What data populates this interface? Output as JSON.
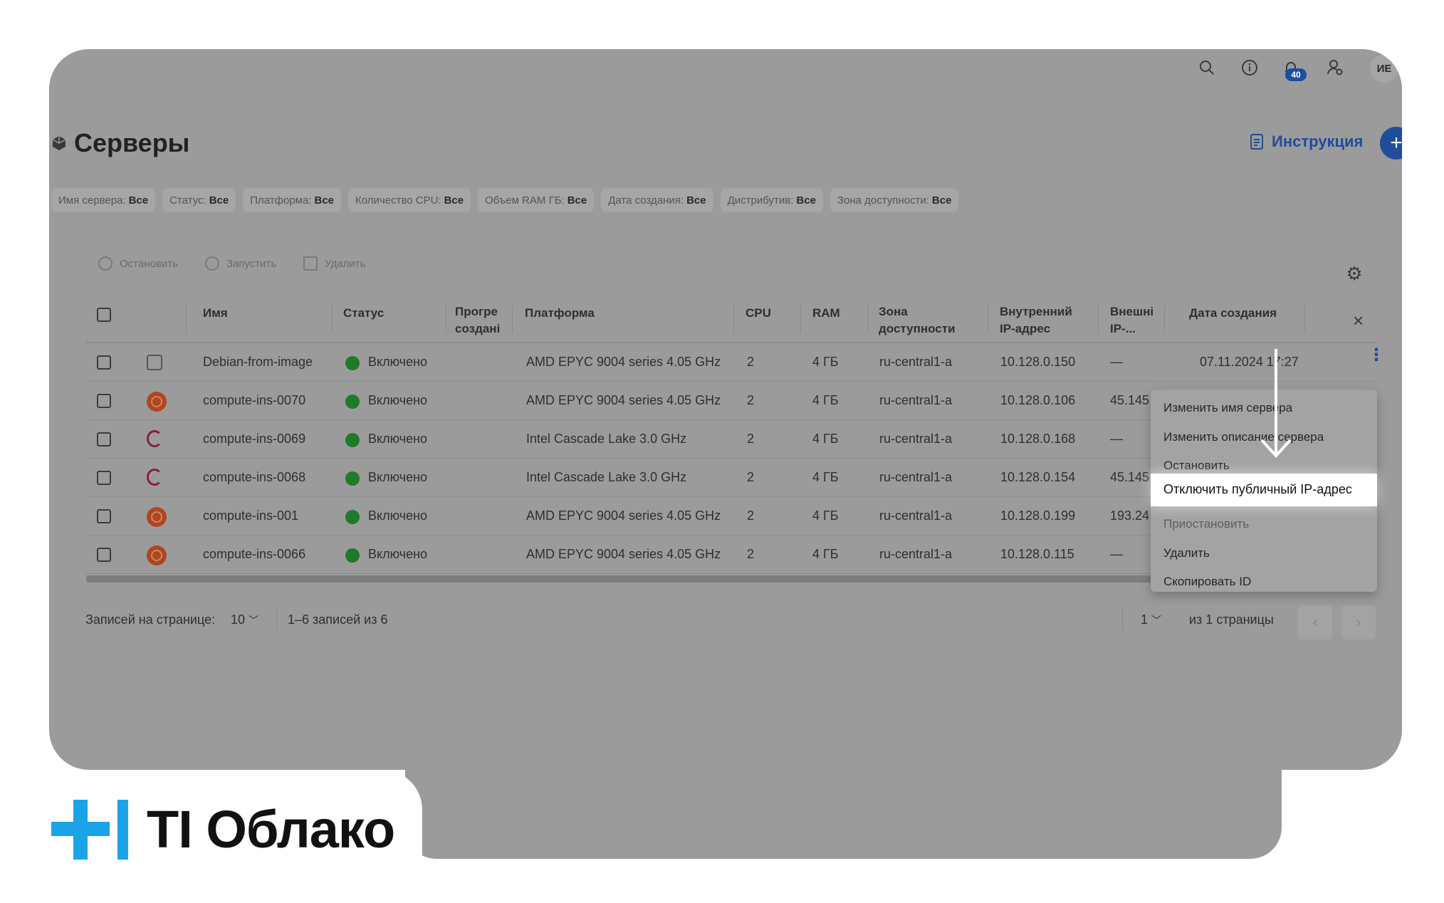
{
  "header": {
    "notification_count": "40",
    "avatar_initials": "ИЕ",
    "icons": [
      "search-icon",
      "info-icon",
      "bell-icon",
      "user-settings-icon"
    ]
  },
  "page": {
    "title": "Серверы",
    "instructions_label": "Инструкция",
    "add_label": "+"
  },
  "filters": [
    {
      "label": "Имя сервера:",
      "value": "Все"
    },
    {
      "label": "Статус:",
      "value": "Все"
    },
    {
      "label": "Платформа:",
      "value": "Все"
    },
    {
      "label": "Количество CPU:",
      "value": "Все"
    },
    {
      "label": "Объем RAM ГБ:",
      "value": "Все"
    },
    {
      "label": "Дата создания:",
      "value": "Все"
    },
    {
      "label": "Дистрибутив:",
      "value": "Все"
    },
    {
      "label": "Зона доступности:",
      "value": "Все"
    }
  ],
  "toolbar": {
    "stop_label": "Остановить",
    "start_label": "Запустить",
    "delete_label": "Удалить"
  },
  "table": {
    "columns": {
      "name": "Имя",
      "status": "Статус",
      "warmup_l1": "Прогре",
      "warmup_l2": "создані",
      "platform": "Платформа",
      "cpu": "CPU",
      "ram": "RAM",
      "zone_l1": "Зона",
      "zone_l2": "доступности",
      "internal_ip_l1": "Внутренний",
      "internal_ip_l2": "IP-адрес",
      "external_ip_l1": "Внешні",
      "external_ip_l2": "IP-...",
      "created": "Дата создания"
    },
    "rows": [
      {
        "os": "image",
        "name": "Debian-from-image",
        "status": "Включено",
        "platform": "AMD EPYC 9004 series 4.05 GHz",
        "cpu": "2",
        "ram": "4 ГБ",
        "zone": "ru-central1-a",
        "internal_ip": "10.128.0.150",
        "external_ip": "—",
        "created": "07.11.2024 17:27"
      },
      {
        "os": "ubuntu",
        "name": "compute-ins-0070",
        "status": "Включено",
        "platform": "AMD EPYC 9004 series 4.05 GHz",
        "cpu": "2",
        "ram": "4 ГБ",
        "zone": "ru-central1-a",
        "internal_ip": "10.128.0.106",
        "external_ip": "45.145",
        "created": ""
      },
      {
        "os": "debian",
        "name": "compute-ins-0069",
        "status": "Включено",
        "platform": "Intel Cascade Lake 3.0 GHz",
        "cpu": "2",
        "ram": "4 ГБ",
        "zone": "ru-central1-a",
        "internal_ip": "10.128.0.168",
        "external_ip": "—",
        "created": ""
      },
      {
        "os": "debian",
        "name": "compute-ins-0068",
        "status": "Включено",
        "platform": "Intel Cascade Lake 3.0 GHz",
        "cpu": "2",
        "ram": "4 ГБ",
        "zone": "ru-central1-a",
        "internal_ip": "10.128.0.154",
        "external_ip": "45.145",
        "created": ""
      },
      {
        "os": "ubuntu",
        "name": "compute-ins-001",
        "status": "Включено",
        "platform": "AMD EPYC 9004 series 4.05 GHz",
        "cpu": "2",
        "ram": "4 ГБ",
        "zone": "ru-central1-a",
        "internal_ip": "10.128.0.199",
        "external_ip": "193.24",
        "created": ""
      },
      {
        "os": "ubuntu",
        "name": "compute-ins-0066",
        "status": "Включено",
        "platform": "AMD EPYC 9004 series 4.05 GHz",
        "cpu": "2",
        "ram": "4 ГБ",
        "zone": "ru-central1-a",
        "internal_ip": "10.128.0.115",
        "external_ip": "—",
        "created": ""
      }
    ]
  },
  "pagination": {
    "per_page_label": "Записей на странице:",
    "per_page_value": "10",
    "range_label": "1–6 записей из 6",
    "page_value": "1",
    "pages_label": "из 1 страницы"
  },
  "context_menu": {
    "items": [
      {
        "label": "Изменить имя сервера",
        "state": "normal"
      },
      {
        "label": "Изменить описание сервера",
        "state": "normal"
      },
      {
        "label": "Остановить",
        "state": "normal"
      },
      {
        "label": "Отключить публичный IP-адрес",
        "state": "highlighted"
      },
      {
        "label": "Приостановить",
        "state": "disabled"
      },
      {
        "label": "Удалить",
        "state": "normal"
      },
      {
        "label": "Скопировать ID",
        "state": "normal"
      }
    ]
  },
  "brand": {
    "name": "TI Облако",
    "accent_color": "#1ba3e8"
  },
  "colors": {
    "status_on": "#1f7a2a",
    "link": "#1f4d9a",
    "overlay": "#9b9b9b"
  }
}
